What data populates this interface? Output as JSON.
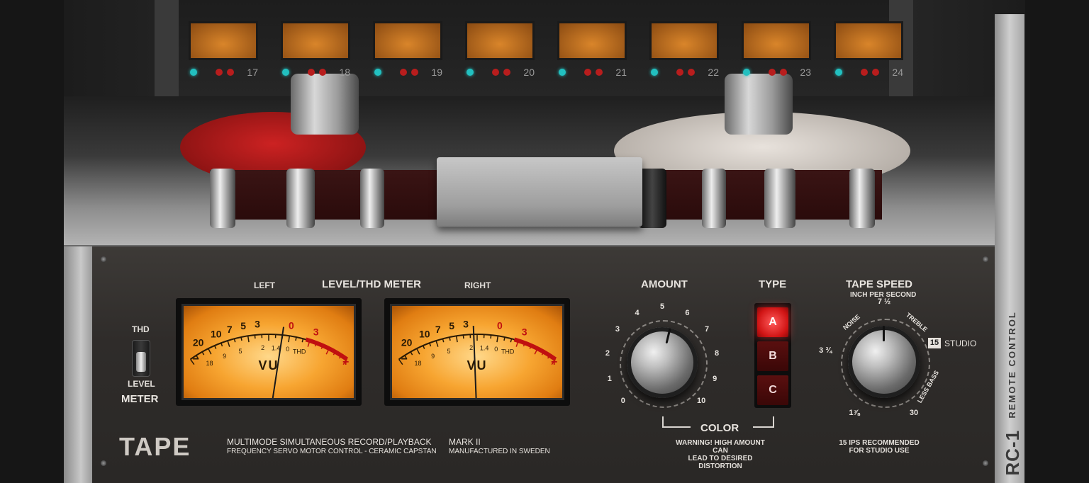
{
  "rack": {
    "channels": [
      "17",
      "18",
      "19",
      "20",
      "21",
      "22",
      "23",
      "24"
    ]
  },
  "panel": {
    "meter_section": {
      "title": "LEVEL/THD METER",
      "left_label": "LEFT",
      "right_label": "RIGHT",
      "switch_top": "THD",
      "switch_bottom": "LEVEL",
      "switch_caption": "METER",
      "vu_text": "VU",
      "scale_top": [
        "20",
        "10",
        "7",
        "5",
        "3",
        "0",
        "3"
      ],
      "scale_bottom": [
        "18",
        "9",
        "5",
        "2",
        "1.4",
        "0",
        "THD"
      ],
      "left_needle": 0.62,
      "right_needle": 0.47
    },
    "amount": {
      "label": "AMOUNT",
      "ticks": [
        "0",
        "1",
        "2",
        "3",
        "4",
        "5",
        "6",
        "7",
        "8",
        "9",
        "10"
      ],
      "value": 5.5
    },
    "type": {
      "label": "TYPE",
      "options": [
        "A",
        "B",
        "C"
      ],
      "selected": "A"
    },
    "color_label": "COLOR",
    "warning": [
      "WARNING! HIGH AMOUNT CAN",
      "LEAD TO DESIRED DISTORTION"
    ],
    "tape_speed": {
      "label": "TAPE SPEED",
      "sublabel": "INCH PER SECOND",
      "ticks": [
        "1⅞",
        "3 ¾",
        "7 ½",
        "15",
        "30"
      ],
      "noise": "NOISE",
      "treble": "TREBLE",
      "less_bass": "LESS BASS",
      "studio_badge": "15",
      "studio_label": "STUDIO",
      "recommend": [
        "15 IPS RECOMMENDED",
        "FOR STUDIO USE"
      ],
      "selected": "7 ½"
    },
    "brand": {
      "name": "TAPE",
      "line1": "MULTIMODE SIMULTANEOUS RECORD/PLAYBACK",
      "line2": "FREQUENCY SERVO MOTOR CONTROL - CERAMIC CAPSTAN",
      "model1": "MARK II",
      "model2": "MANUFACTURED IN SWEDEN"
    }
  },
  "remote": {
    "name": "RC-1",
    "label": "REMOTE CONTROL"
  },
  "colors": {
    "vu_amber": "#f7a531",
    "led_red": "#d01414",
    "led_cyan": "#22c0c0",
    "reel_red": "#b01818"
  }
}
